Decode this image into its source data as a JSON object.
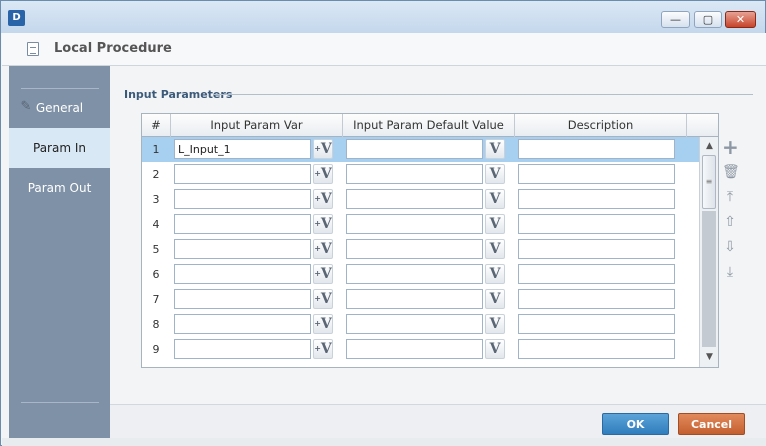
{
  "window": {
    "logo": "D",
    "min_glyph": "—",
    "max_glyph": "▢",
    "close_glyph": "✕"
  },
  "header": {
    "title": "Local Procedure"
  },
  "nav": {
    "items": [
      {
        "label": "General"
      },
      {
        "label": "Param In"
      },
      {
        "label": "Param Out"
      }
    ]
  },
  "section": {
    "title": "Input Parameters"
  },
  "table": {
    "columns": [
      "#",
      "Input Param Var",
      "Input Param Default Value",
      "Description"
    ],
    "rows": [
      {
        "num": "1",
        "var": "L_Input_1",
        "default": "",
        "desc": ""
      },
      {
        "num": "2",
        "var": "",
        "default": "",
        "desc": ""
      },
      {
        "num": "3",
        "var": "",
        "default": "",
        "desc": ""
      },
      {
        "num": "4",
        "var": "",
        "default": "",
        "desc": ""
      },
      {
        "num": "5",
        "var": "",
        "default": "",
        "desc": ""
      },
      {
        "num": "6",
        "var": "",
        "default": "",
        "desc": ""
      },
      {
        "num": "7",
        "var": "",
        "default": "",
        "desc": ""
      },
      {
        "num": "8",
        "var": "",
        "default": "",
        "desc": ""
      },
      {
        "num": "9",
        "var": "",
        "default": "",
        "desc": ""
      }
    ],
    "var_button_glyph": "V",
    "var_button_arrow": "+",
    "selected_row": 1
  },
  "scroll": {
    "up": "▲",
    "down": "▼",
    "grip": "≡"
  },
  "tools": {
    "add": "+",
    "delete": "🗑",
    "top": "⤒",
    "up": "⇧",
    "down": "⇩",
    "bottom": "⤓"
  },
  "footer": {
    "ok_label": "OK",
    "cancel_label": "Cancel"
  },
  "colors": {
    "selected_row": "#a6cff0",
    "ok": "#2f7dbd",
    "cancel": "#c45f2f",
    "nav": "#7f91a6"
  }
}
